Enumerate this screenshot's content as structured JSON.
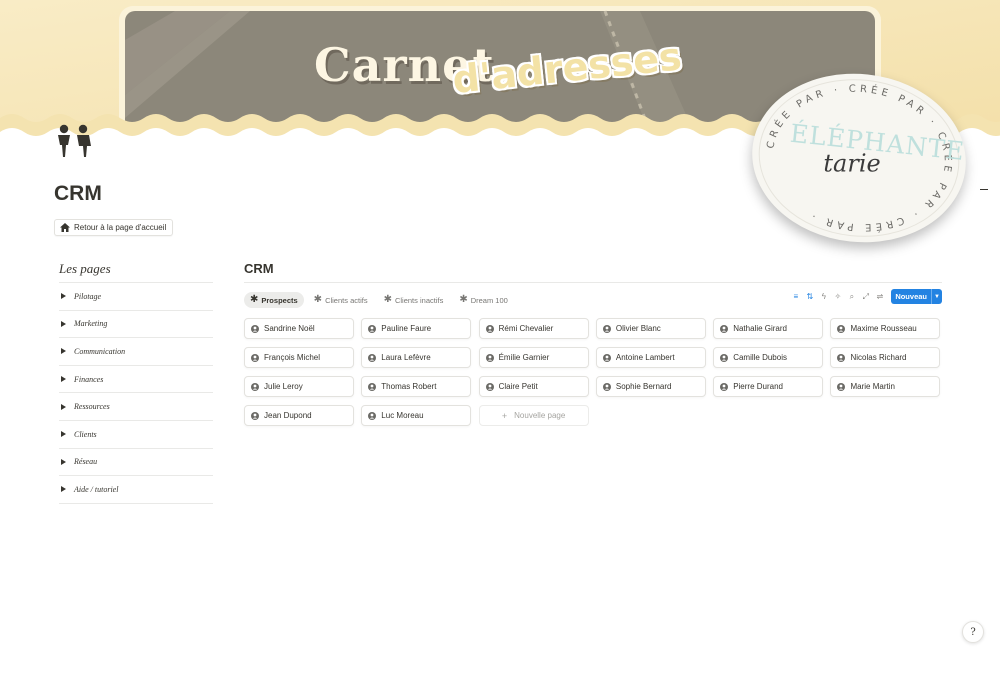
{
  "banner": {
    "title_main": "Carnet",
    "title_script": "d'adresses"
  },
  "stamp": {
    "ring_text": "CRÉE PAR · CRÉE PAR · CRÉE PAR · CRÉE PAR ·",
    "brand": "ÉLÉPHANTE",
    "script": "tarie"
  },
  "page": {
    "title": "CRM",
    "home_button": "Retour à la page d'accueil"
  },
  "sidebar": {
    "title": "Les pages",
    "items": [
      {
        "label": "Pilotage"
      },
      {
        "label": "Marketing"
      },
      {
        "label": "Communication"
      },
      {
        "label": "Finances"
      },
      {
        "label": "Ressources"
      },
      {
        "label": "Clients"
      },
      {
        "label": "Réseau"
      },
      {
        "label": "Aide / tutoriel"
      }
    ]
  },
  "database": {
    "title": "CRM",
    "tabs": [
      {
        "label": "Prospects",
        "active": true
      },
      {
        "label": "Clients actifs",
        "active": false
      },
      {
        "label": "Clients inactifs",
        "active": false
      },
      {
        "label": "Dream 100",
        "active": false
      }
    ],
    "new_button": "Nouveau",
    "new_page": "Nouvelle page",
    "cards": [
      "Sandrine Noël",
      "Pauline Faure",
      "Rémi Chevalier",
      "Olivier Blanc",
      "Nathalie Girard",
      "Maxime Rousseau",
      "François Michel",
      "Laura Lefèvre",
      "Émilie Garnier",
      "Antoine Lambert",
      "Camille Dubois",
      "Nicolas Richard",
      "Julie Leroy",
      "Thomas Robert",
      "Claire Petit",
      "Sophie Bernard",
      "Pierre Durand",
      "Marie Martin",
      "Jean Dupond",
      "Luc Moreau"
    ]
  },
  "colors": {
    "accent": "#2383e2",
    "banner_cream": "#f6e7b9",
    "banner_photo": "#8a8576"
  }
}
